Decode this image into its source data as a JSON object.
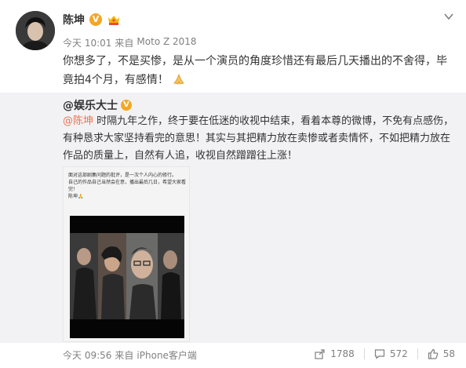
{
  "author": {
    "name": "陈坤",
    "verified_badge": "V",
    "member_icon": "crown-member-icon",
    "avatar_icon": "avatar-photo"
  },
  "post": {
    "time": "今天 10:01",
    "source_prefix": "来自",
    "source": "Moto Z 2018",
    "text": "你想多了，不是买惨，是从一个演员的角度珍惜还有最后几天播出的不舍得，毕竟拍4个月，有感情！",
    "emoji": "praying-hands-emoji"
  },
  "repost": {
    "author": "@娱乐大士",
    "verified_badge": "V",
    "mention": "@陈坤",
    "text": " 时隔九年之作，终于要在低迷的收视中结束，看着本尊的微博，不免有点感伤，有种恳求大家坚持看完的意思！其实与其把精力放在卖惨或者卖情怀，不如把精力放在作品的质量上，自然有人追，收视自然蹭蹭往上涨！",
    "image_caption": "面对这部剧集问题的批评，是一次个人内心的修行。\n自己的作品自己当然会在意，播出最后几日，希望大家看完！\n陈坤🙏",
    "time": "今天 09:56",
    "source_prefix": "来自",
    "source": "iPhone客户端"
  },
  "actions": {
    "share": "1788",
    "comment": "572",
    "like": "58"
  },
  "colors": {
    "accent": "#eb7350",
    "badge": "#f5a623",
    "repost_bg": "#f2f2f5"
  }
}
